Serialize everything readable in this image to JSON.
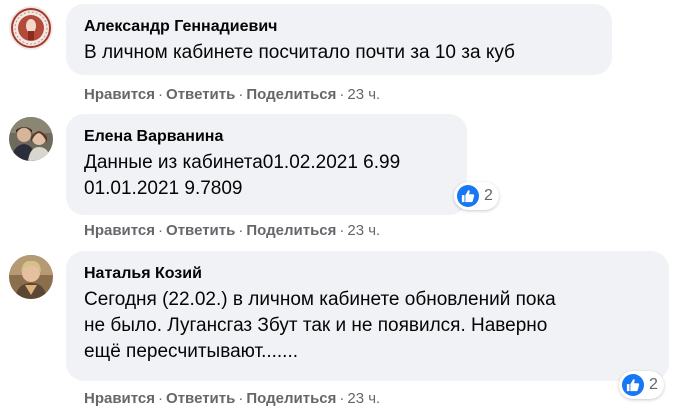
{
  "comments": [
    {
      "author": "Александр Геннадиевич",
      "text": "В личном кабинете посчитало почти за 10 за куб",
      "like_label": "Нравится",
      "reply_label": "Ответить",
      "share_label": "Поделиться",
      "time": "23 ч.",
      "reactions": null
    },
    {
      "author": "Елена Варванина",
      "text": "Данные из кабинета01.02.2021 6.99\n01.01.2021 9.7809",
      "like_label": "Нравится",
      "reply_label": "Ответить",
      "share_label": "Поделиться",
      "time": "23 ч.",
      "reactions": "2"
    },
    {
      "author": "Наталья Козий",
      "text": "Сегодня (22.02.) в личном кабинете обновлений пока\nне было. Лугансгаз Збут так и не появился. Наверно\nещё пересчитывают.......",
      "like_label": "Нравится",
      "reply_label": "Ответить",
      "share_label": "Поделиться",
      "time": "23 ч.",
      "reactions": "2"
    }
  ],
  "separator": "·",
  "colors": {
    "bubble": "#f0f2f5",
    "meta_text": "#65676b",
    "like_blue": "#1877f2",
    "text": "#050505"
  },
  "icons": {
    "reaction": "like-icon"
  }
}
